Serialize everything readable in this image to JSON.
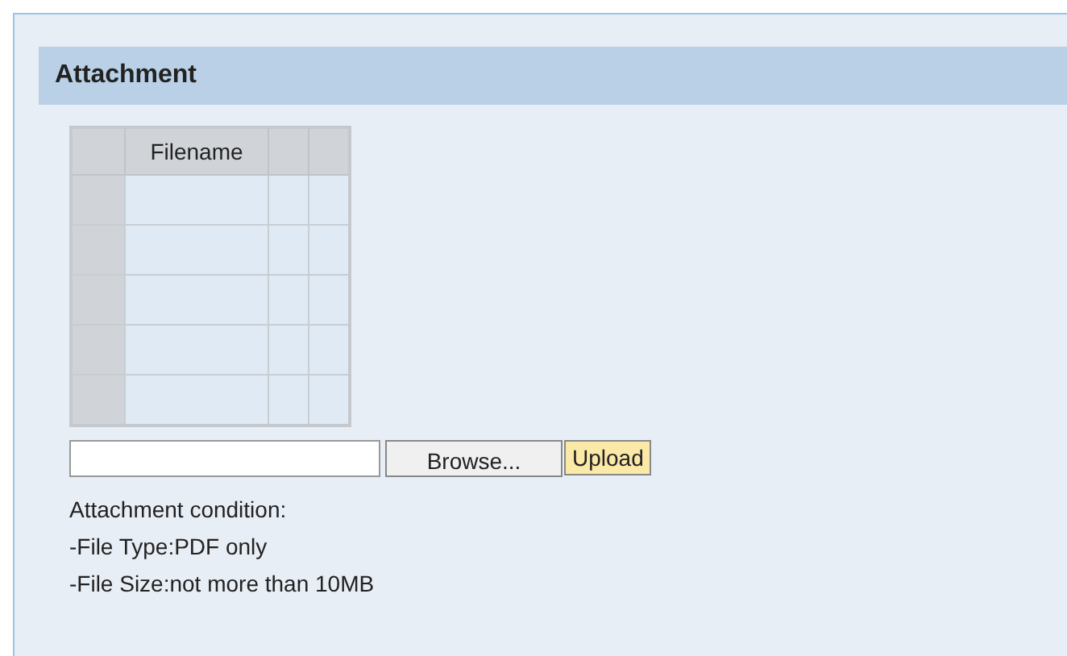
{
  "section": {
    "title": "Attachment"
  },
  "table": {
    "columns": [
      {
        "kind": "selector"
      },
      {
        "kind": "text",
        "label": "Filename"
      },
      {
        "kind": "blank"
      },
      {
        "kind": "blank"
      }
    ],
    "rows": [
      {
        "kind": "empty"
      },
      {
        "kind": "empty"
      },
      {
        "kind": "empty"
      },
      {
        "kind": "empty"
      },
      {
        "kind": "empty"
      }
    ]
  },
  "upload": {
    "browse_label": "Browse...",
    "upload_label": "Upload"
  },
  "conditions": [
    "Attachment condition:",
    "-File Type:PDF only",
    "-File Size:not more than 10MB"
  ]
}
